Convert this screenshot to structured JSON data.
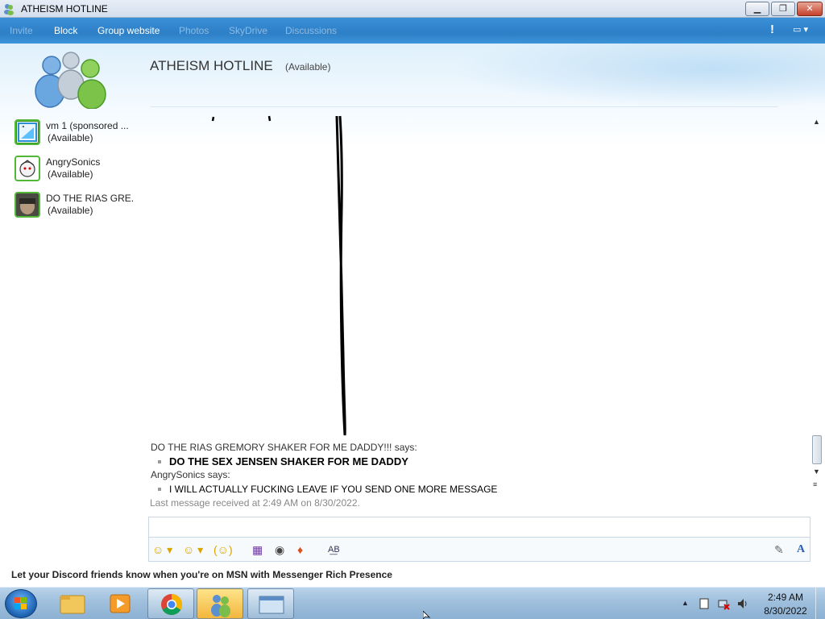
{
  "window": {
    "title": "ATHEISM HOTLINE",
    "minimize_label": "▁",
    "maximize_label": "❐",
    "close_label": "✕"
  },
  "menu": {
    "items": [
      {
        "label": "Invite",
        "enabled": false
      },
      {
        "label": "Block",
        "enabled": true
      },
      {
        "label": "Group website",
        "enabled": true
      },
      {
        "label": "Photos",
        "enabled": false
      },
      {
        "label": "SkyDrive",
        "enabled": false
      },
      {
        "label": "Discussions",
        "enabled": false
      }
    ],
    "alert_glyph": "!",
    "options_glyph": "▭ ▾"
  },
  "header": {
    "title": "ATHEISM HOTLINE",
    "status": "(Available)"
  },
  "contacts": [
    {
      "name": "vm 1 (sponsored ...",
      "status": "(Available)",
      "avatar": "sponsored-avatar"
    },
    {
      "name": "AngrySonics",
      "status": "(Available)",
      "avatar": "sonic-avatar"
    },
    {
      "name": "DO THE RIAS GRE...",
      "status": "(Available)",
      "avatar": "photo-avatar"
    }
  ],
  "messages": [
    {
      "sender": "DO THE RIAS GREMORY SHAKER FOR ME DADDY!!! says:",
      "text": "DO THE SEX JENSEN SHAKER FOR ME DADDY",
      "bold": true
    },
    {
      "sender": "AngrySonics says:",
      "text": "I WILL ACTUALLY FUCKING LEAVE IF YOU SEND ONE MORE MESSAGE",
      "bold": false
    }
  ],
  "last_received": "Last message received at 2:49 AM on 8/30/2022.",
  "input": {
    "value": ""
  },
  "toolbar": {
    "emoticon_label": "☺ ▾",
    "wink_label": "☺ ▾",
    "nudge_label": "(☺)",
    "background_label": "▦",
    "voice_clip_label": "◉",
    "games_label": "♦",
    "spell_label": "A͟B",
    "handwriting_label": "✎",
    "font_label": "A"
  },
  "ad_text": "Let your Discord friends know when you're on MSN with Messenger Rich Presence",
  "taskbar": {
    "time": "2:49 AM",
    "date": "8/30/2022",
    "tray_expand": "▲"
  },
  "colors": {
    "menubar": "#2d7fc6",
    "available_green": "#52b737",
    "title_text": "#333333"
  }
}
